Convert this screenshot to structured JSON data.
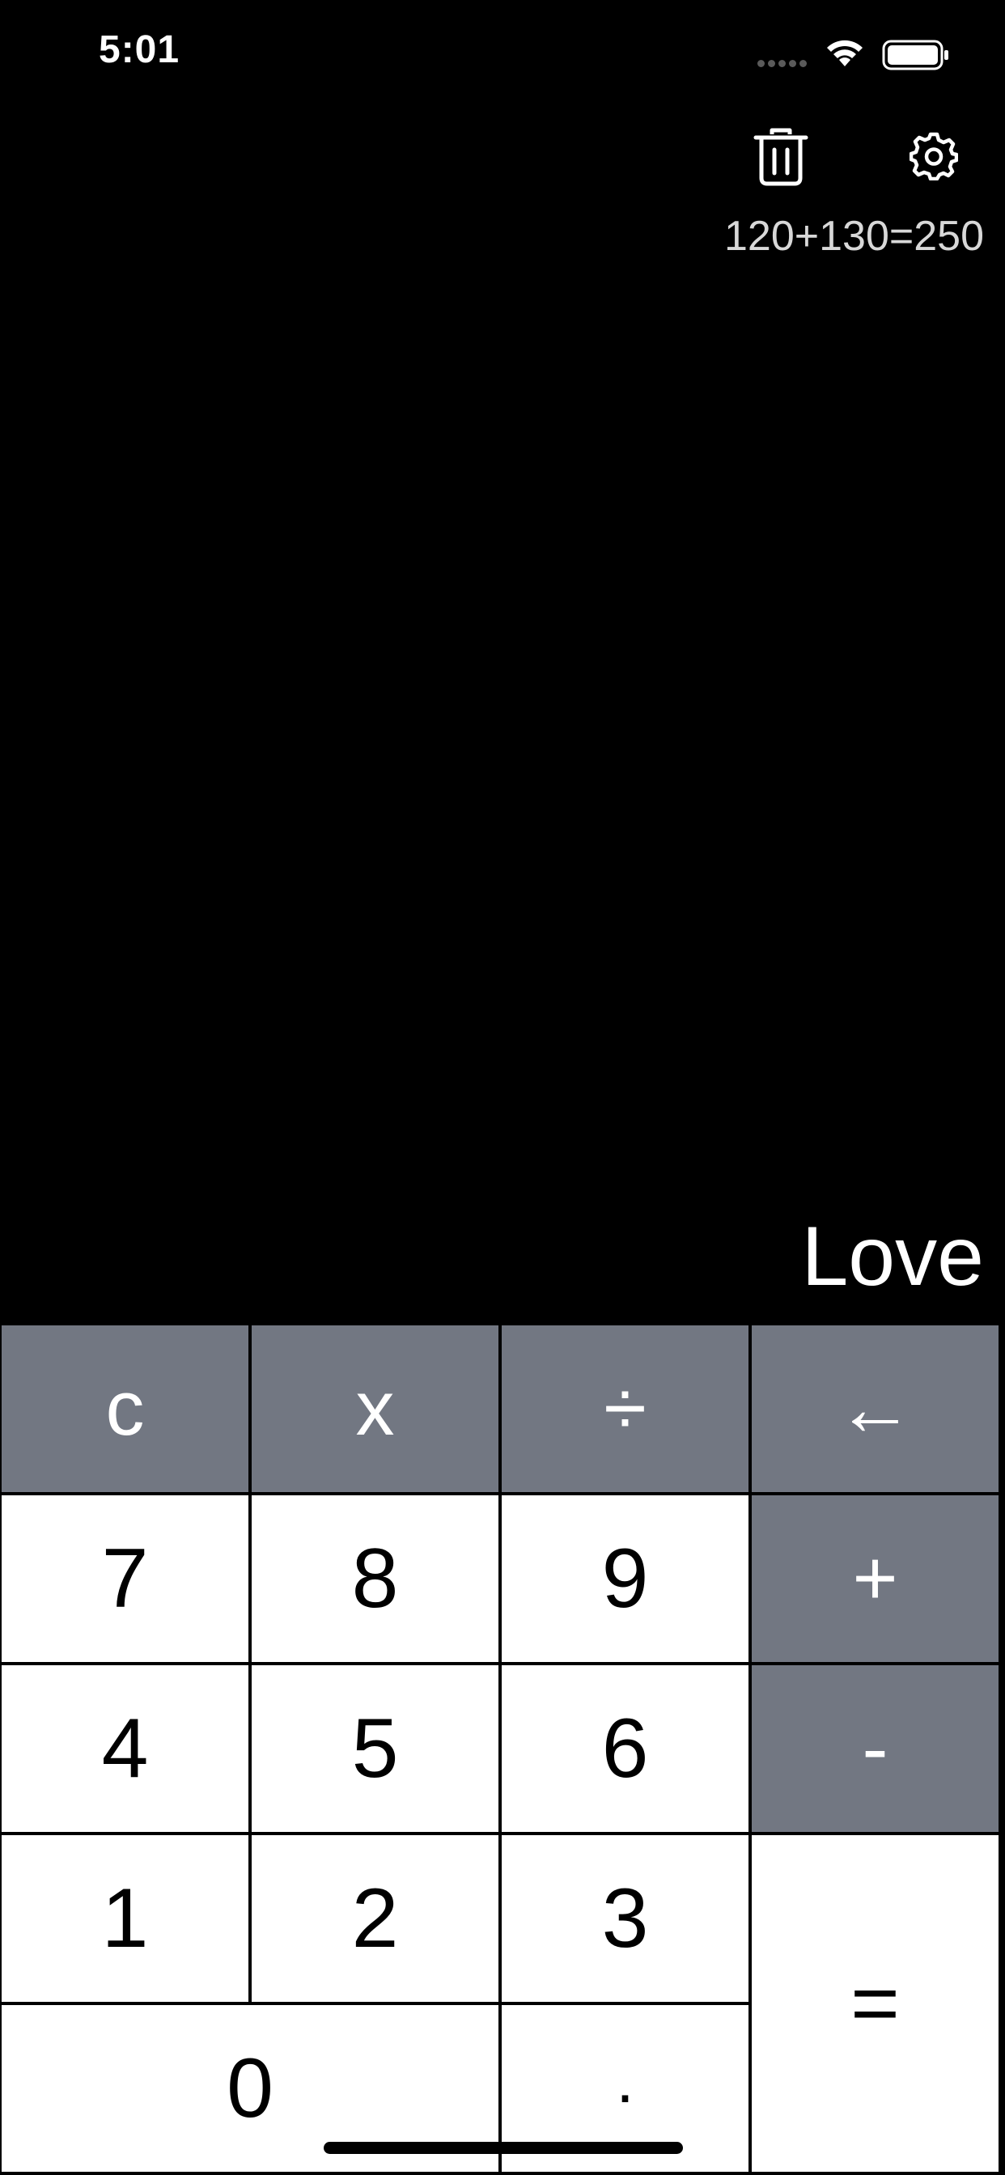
{
  "status_bar": {
    "time": "5:01"
  },
  "toolbar": {
    "trash_icon": "trash-icon",
    "settings_icon": "gear-icon"
  },
  "history": {
    "entries": [
      "120+130=250"
    ]
  },
  "display": {
    "value": "Love"
  },
  "keypad": {
    "row1": [
      "c",
      "x",
      "÷",
      "←"
    ],
    "row2": [
      "7",
      "8",
      "9",
      "+"
    ],
    "row3": [
      "4",
      "5",
      "6",
      "-"
    ],
    "row4": [
      "1",
      "2",
      "3",
      "="
    ],
    "row5": [
      "0",
      "."
    ]
  },
  "colors": {
    "background": "#000000",
    "operator_key": "#727782",
    "digit_key": "#ffffff",
    "history_text": "#d8d8d8"
  }
}
